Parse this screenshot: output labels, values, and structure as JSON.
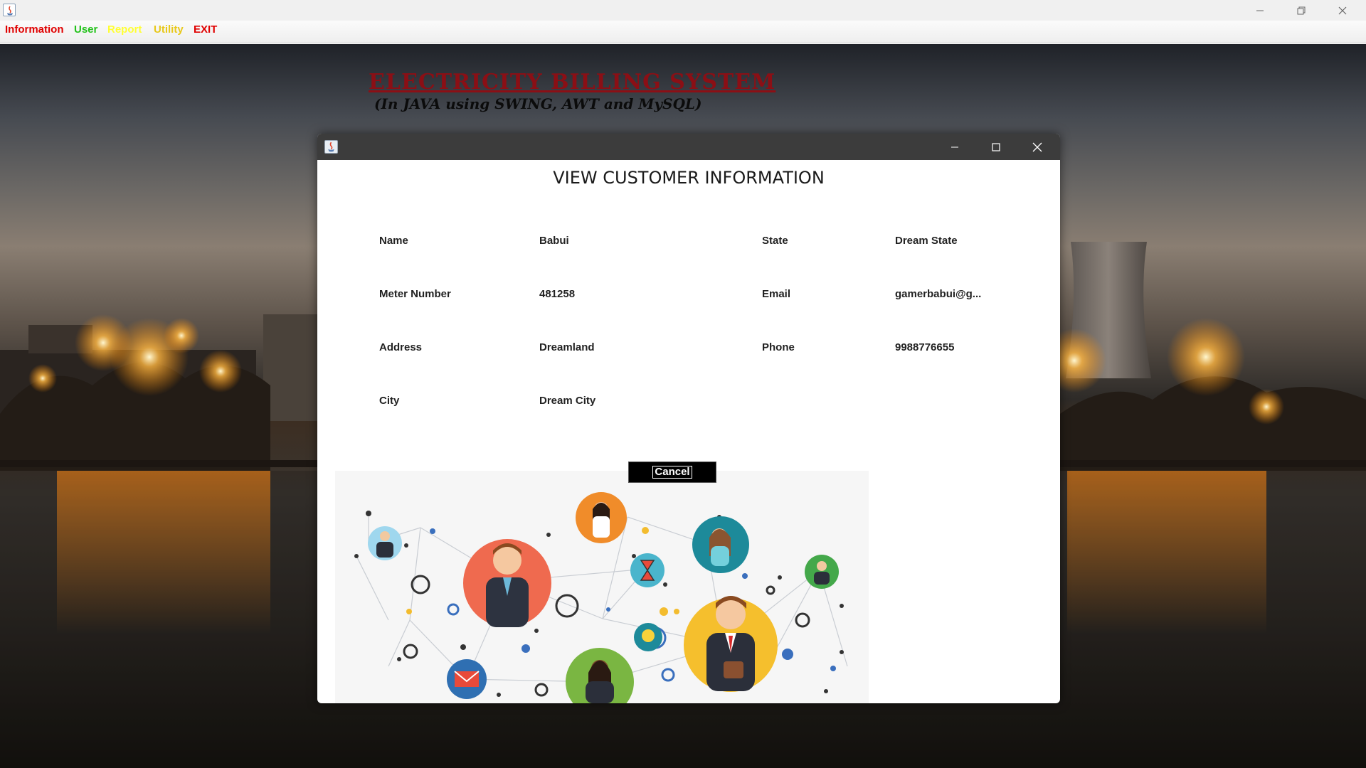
{
  "menu": {
    "information": "Information",
    "user": "User",
    "report": "Report",
    "utility": "Utility",
    "exit": "EXIT"
  },
  "colors": {
    "information": "#e00000",
    "user": "#22c21a",
    "report": "#ffff33",
    "utility": "#e8c81a",
    "exit": "#e00000",
    "heading": "#8b0f15",
    "dialog_titlebar": "#3c3c3c"
  },
  "heading": {
    "title": "ELECTRICITY BILLING SYSTEM",
    "subtitle": "(In JAVA using SWING, AWT and MySQL)"
  },
  "dialog": {
    "title": "VIEW CUSTOMER INFORMATION",
    "fields": {
      "name_label": "Name",
      "name_value": "Babui",
      "meter_label": "Meter Number",
      "meter_value": "481258",
      "address_label": "Address",
      "address_value": "Dreamland",
      "city_label": "City",
      "city_value": "Dream City",
      "state_label": "State",
      "state_value": "Dream State",
      "email_label": "Email",
      "email_value": "gamerbabui@g...",
      "phone_label": "Phone",
      "phone_value": "9988776655"
    },
    "cancel_label": "Cancel"
  },
  "icons": {
    "window_minimize": "minimize-icon",
    "window_restore": "restore-icon",
    "window_close": "close-icon",
    "app": "java-app-icon",
    "illustration": "customer-network-illustration"
  }
}
